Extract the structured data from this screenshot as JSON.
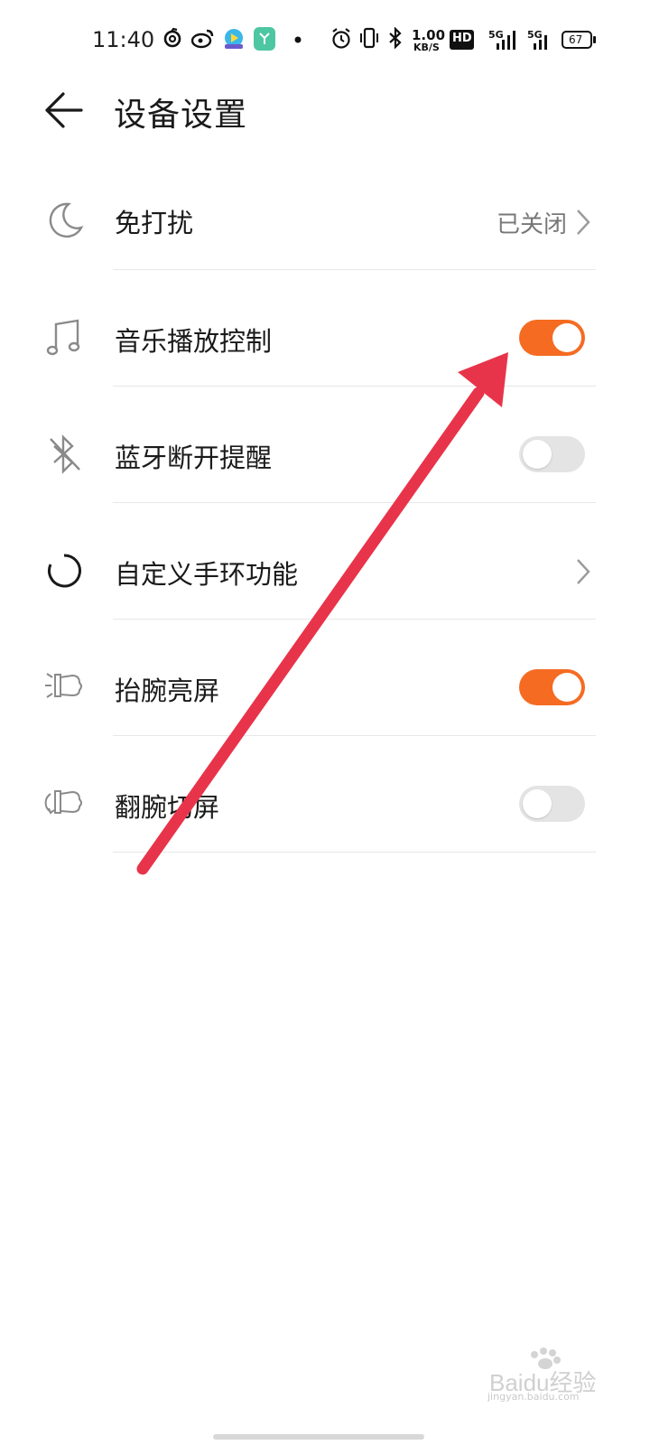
{
  "status_bar": {
    "time": "11:40",
    "net_speed_value": "1.00",
    "net_speed_unit": "KB/S",
    "hd_badge": "HD",
    "signal1_label": "5G",
    "signal2_label": "5G",
    "battery": "67",
    "icons": [
      "netease-music-icon",
      "weibo-icon",
      "video-app-icon",
      "app-icon",
      "dot-icon",
      "alarm-icon",
      "vibrate-icon",
      "bluetooth-icon",
      "hd-icon",
      "signal-icon",
      "signal-icon",
      "battery-icon"
    ]
  },
  "header": {
    "title": "设备设置",
    "back_icon": "back-arrow-icon"
  },
  "settings": [
    {
      "label": "免打扰",
      "icon": "moon-icon",
      "control": "link",
      "value": "已关闭"
    },
    {
      "label": "音乐播放控制",
      "icon": "music-note-icon",
      "control": "toggle",
      "state": "on"
    },
    {
      "label": "蓝牙断开提醒",
      "icon": "bluetooth-off-icon",
      "control": "toggle",
      "state": "off"
    },
    {
      "label": "自定义手环功能",
      "icon": "circle-ring-icon",
      "control": "link",
      "value": ""
    },
    {
      "label": "抬腕亮屏",
      "icon": "raise-wrist-icon",
      "control": "toggle",
      "state": "on"
    },
    {
      "label": "翻腕切屏",
      "icon": "flip-wrist-icon",
      "control": "toggle",
      "state": "off"
    }
  ],
  "colors": {
    "accent": "#f56b22",
    "toggle_off": "#e4e4e4",
    "annotation_arrow": "#e8344a"
  },
  "watermark": {
    "brand": "Baidu经验",
    "url": "jingyan.baidu.com"
  }
}
